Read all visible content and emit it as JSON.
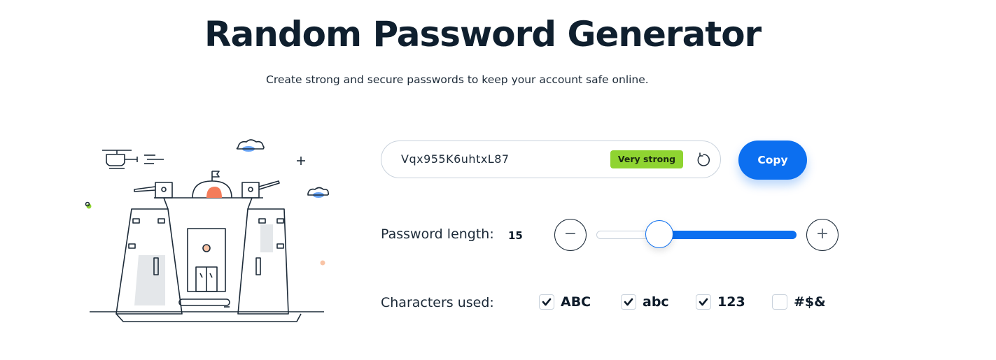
{
  "header": {
    "title": "Random Password Generator",
    "subtitle": "Create strong and secure passwords to keep your account safe online."
  },
  "generator": {
    "password": "Vqx955K6uhtxL87",
    "strength": "Very strong",
    "strength_color": "#8fd431",
    "copy_label": "Copy",
    "refresh_icon": "refresh-icon"
  },
  "length": {
    "label": "Password length:",
    "value": "15",
    "min": 1,
    "max": 50,
    "decrement_symbol": "−",
    "increment_symbol": "+"
  },
  "characters": {
    "label": "Characters used:",
    "options": [
      {
        "label": "ABC",
        "checked": true
      },
      {
        "label": "abc",
        "checked": true
      },
      {
        "label": "123",
        "checked": true
      },
      {
        "label": "#$&",
        "checked": false
      }
    ]
  },
  "colors": {
    "accent": "#0c6ff0",
    "text": "#0d1b2a",
    "border": "#c9d2dc"
  }
}
